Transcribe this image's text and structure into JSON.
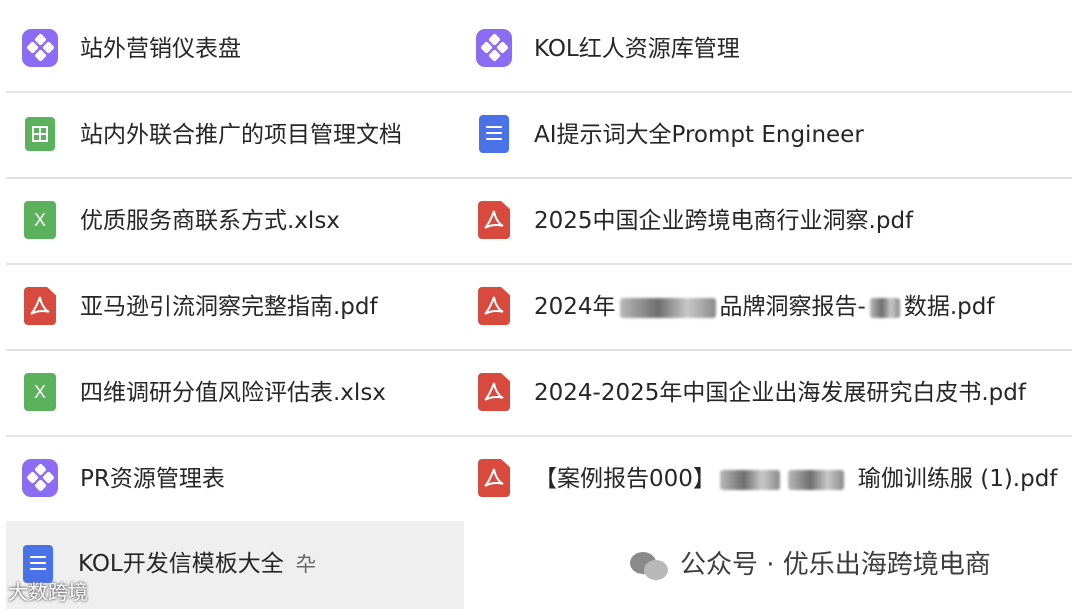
{
  "files": {
    "left": [
      {
        "name": "站外营销仪表盘",
        "icon": "base-app-icon"
      },
      {
        "name": "站内外联合推广的项目管理文档",
        "icon": "sheet-grid-icon"
      },
      {
        "name": "优质服务商联系方式.xlsx",
        "icon": "excel-file-icon",
        "icon_text": "X"
      },
      {
        "name": "亚马逊引流洞察完整指南.pdf",
        "icon": "pdf-file-icon"
      },
      {
        "name": "四维调研分值风险评估表.xlsx",
        "icon": "excel-file-icon",
        "icon_text": "X"
      },
      {
        "name": "PR资源管理表",
        "icon": "base-app-icon"
      },
      {
        "name": "KOL开发信模板大全",
        "icon": "doc-file-icon",
        "pin": "卆"
      }
    ],
    "right": [
      {
        "name": "KOL红人资源库管理",
        "icon": "base-app-icon"
      },
      {
        "name": "AI提示词大全Prompt Engineer",
        "icon": "doc-file-icon"
      },
      {
        "name": "2025中国企业跨境电商行业洞察.pdf",
        "icon": "pdf-file-icon"
      },
      {
        "name_prefix": "2024年",
        "name_mid": "品牌洞察报告-",
        "name_suffix": "数据.pdf",
        "icon": "pdf-file-icon"
      },
      {
        "name": "2024-2025年中国企业出海发展研究白皮书.pdf",
        "icon": "pdf-file-icon"
      },
      {
        "name_prefix": "【案例报告000】",
        "name_suffix": "瑜伽训练服 (1).pdf",
        "icon": "pdf-file-icon"
      }
    ]
  },
  "watermark": {
    "text": "公众号 · 优乐出海跨境电商"
  },
  "corner_watermark": {
    "text": "大数跨境"
  },
  "colors": {
    "base_purple": "#8b6cf2",
    "sheet_green": "#5cb15c",
    "doc_blue": "#4a72e8",
    "pdf_red": "#d94a3e"
  }
}
